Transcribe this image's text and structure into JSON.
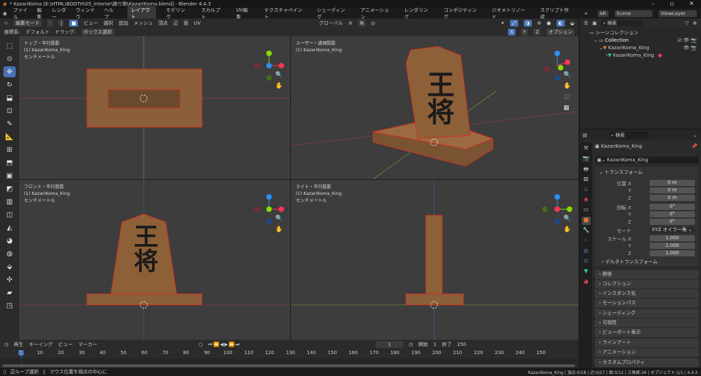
{
  "title": "* KazariKoma [E:\\HTML\\BOOTH\\05_Interior\\飾り駒\\KazariKoma.blend] - Blender 4.4.3",
  "menu": [
    "ファイル",
    "編集",
    "レンダー",
    "ウィンドウ",
    "ヘルプ"
  ],
  "workspaces": [
    "レイアウト",
    "モデリング",
    "スカルプト",
    "UV編集",
    "テクスチャペイント",
    "シェーディング",
    "アニメーション",
    "レンダリング",
    "コンポジティング",
    "ジオメトリノード",
    "スクリプト作成",
    "+"
  ],
  "scene": {
    "label": "Scene",
    "viewlayer": "ViewLayer",
    "ar": "AR"
  },
  "header": {
    "mode": "編集モード",
    "menus": [
      "ビュー",
      "選択",
      "追加",
      "メッシュ",
      "頂点",
      "辺",
      "面",
      "UV"
    ],
    "transform": "グローバル",
    "axes": [
      "X",
      "Y",
      "Z"
    ],
    "options": "オプション"
  },
  "toolheader": {
    "coord_label": "座標系:",
    "coord": "デフォルト",
    "drag_label": "ドラッグ:",
    "drag": "ボックス選択"
  },
  "viewports": [
    {
      "name": "top",
      "lines": [
        "トップ・平行投影",
        "(1) KazariKoma_King",
        "センチメートル"
      ]
    },
    {
      "name": "user",
      "lines": [
        "ユーザー・透視投影",
        "(1) KazariKoma_King",
        ""
      ]
    },
    {
      "name": "front",
      "lines": [
        "フロント・平行投影",
        "(1) KazariKoma_King",
        "センチメートル"
      ]
    },
    {
      "name": "right",
      "lines": [
        "ライト・平行投影",
        "(1) KazariKoma_King",
        "センチメートル"
      ]
    }
  ],
  "piece_char": "王将",
  "outliner": {
    "search": "検索",
    "scene_collection": "シーンコレクション",
    "collection": "Collection",
    "object": "KazariKoma_King",
    "mesh": "KazariKoma_King"
  },
  "properties": {
    "search": "検索",
    "object": "KazariKoma_King",
    "object_field": "KazariKoma_King",
    "transform": "トランスフォーム",
    "location_label": "位置",
    "rotation_label": "回転",
    "scale_label": "スケール",
    "mode_label": "モード",
    "mode": "XYZ オイラー角",
    "location": [
      "0 m",
      "0 m",
      "0 m"
    ],
    "rotation": [
      "0°",
      "0°",
      "0°"
    ],
    "scale": [
      "1.000",
      "1.000",
      "1.000"
    ],
    "axes": [
      "X",
      "Y",
      "Z"
    ],
    "delta": "デルタトランスフォーム",
    "panels": [
      "関係",
      "コレクション",
      "インスタンス化",
      "モーションパス",
      "シェーディング",
      "可視性",
      "ビューポート表示",
      "ラインアート",
      "アニメーション",
      "カスタムプロパティ"
    ]
  },
  "timeline": {
    "menus": [
      "再生",
      "キーイング",
      "ビュー",
      "マーカー"
    ],
    "current": "1",
    "start_label": "開始",
    "start": "1",
    "end_label": "終了",
    "end": "250",
    "ticks": [
      "1",
      "10",
      "20",
      "30",
      "40",
      "50",
      "60",
      "70",
      "80",
      "90",
      "100",
      "110",
      "120",
      "130",
      "140",
      "150",
      "160",
      "170",
      "180",
      "190",
      "200",
      "210",
      "220",
      "230",
      "240",
      "250"
    ]
  },
  "status": {
    "left1": "辺ループ選択",
    "left2": "マウス位置を視点の中心に",
    "right": "KazariKoma_King | 頂点:0/18 | 辺:0/27 | 面:0/12 | 三角面:26 | オブジェクト:1/1 | 4.4.3"
  }
}
